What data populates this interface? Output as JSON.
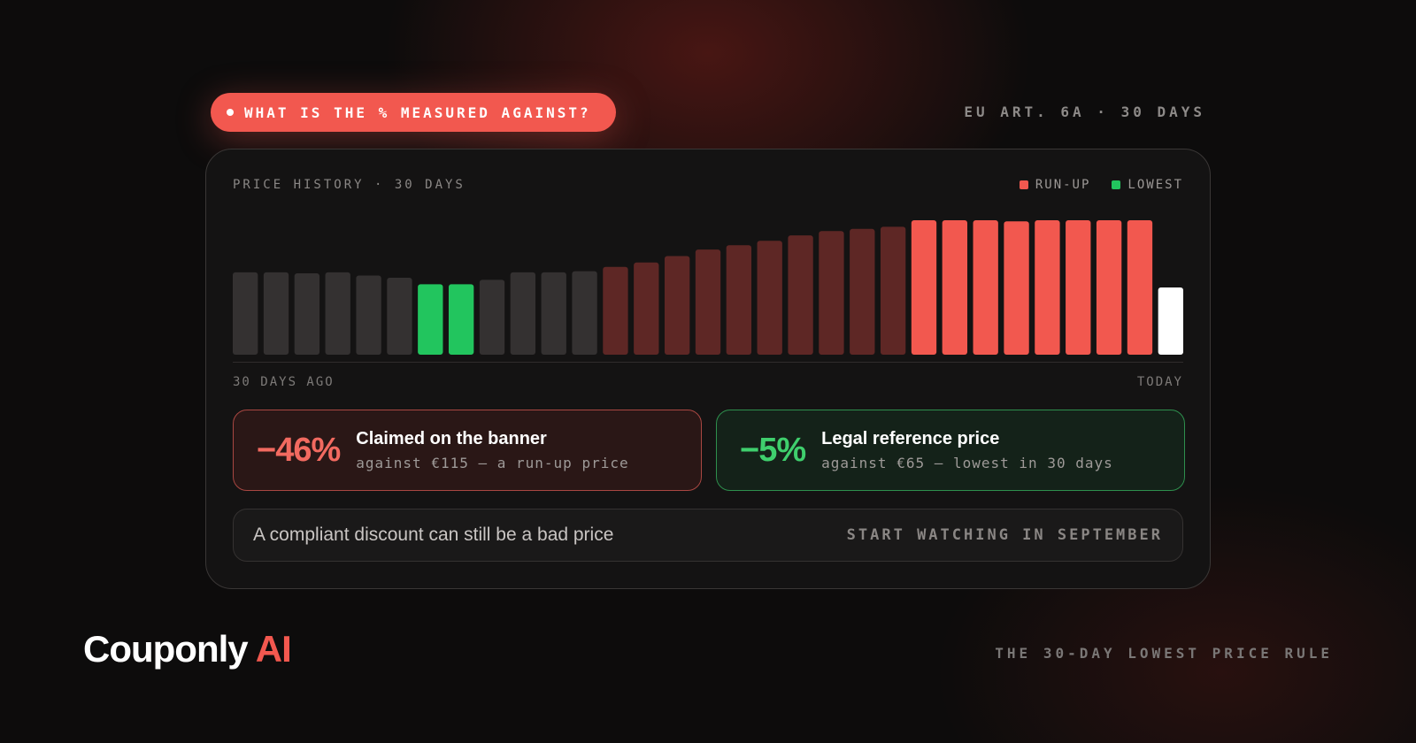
{
  "header": {
    "question": "WHAT IS THE % MEASURED AGAINST?",
    "tag": "EU ART. 6A · 30 DAYS"
  },
  "card": {
    "title": "PRICE HISTORY · 30 DAYS",
    "legend": [
      {
        "label": "RUN-UP",
        "color": "#f2584f"
      },
      {
        "label": "LOWEST",
        "color": "#22c55e"
      }
    ],
    "axis_start": "30 DAYS AGO",
    "axis_end": "TODAY"
  },
  "chart_data": {
    "type": "bar",
    "ylim": [
      0,
      115
    ],
    "values": [
      76,
      76,
      75,
      76,
      73,
      71,
      65,
      65,
      69,
      76,
      76,
      77,
      81,
      85,
      91,
      97,
      101,
      105,
      110,
      114,
      116,
      118,
      124,
      124,
      124,
      123,
      124,
      124,
      124,
      124,
      62
    ],
    "groups": [
      "normal",
      "normal",
      "normal",
      "normal",
      "normal",
      "normal",
      "lowest",
      "lowest",
      "normal",
      "normal",
      "normal",
      "normal",
      "rising",
      "rising",
      "rising",
      "rising",
      "rising",
      "rising",
      "rising",
      "rising",
      "rising",
      "rising",
      "runup",
      "runup",
      "runup",
      "runup",
      "runup",
      "runup",
      "runup",
      "runup",
      "current"
    ],
    "colors": {
      "normal": "#343131",
      "lowest": "#22c55e",
      "rising": "#5e2725",
      "runup": "#f2584f",
      "current": "#ffffff"
    }
  },
  "stats": {
    "claimed": {
      "pct": "−46%",
      "heading": "Claimed on the banner",
      "sub": "against €115 — a run-up price"
    },
    "legal": {
      "pct": "−5%",
      "heading": "Legal reference price",
      "sub": "against €65 — lowest in 30 days"
    }
  },
  "note": {
    "text": "A compliant discount can still be a bad price",
    "cta": "START WATCHING IN SEPTEMBER"
  },
  "footer": {
    "brand_main": "Couponly",
    "brand_accent": "AI",
    "tagline": "THE 30-DAY LOWEST PRICE RULE"
  }
}
